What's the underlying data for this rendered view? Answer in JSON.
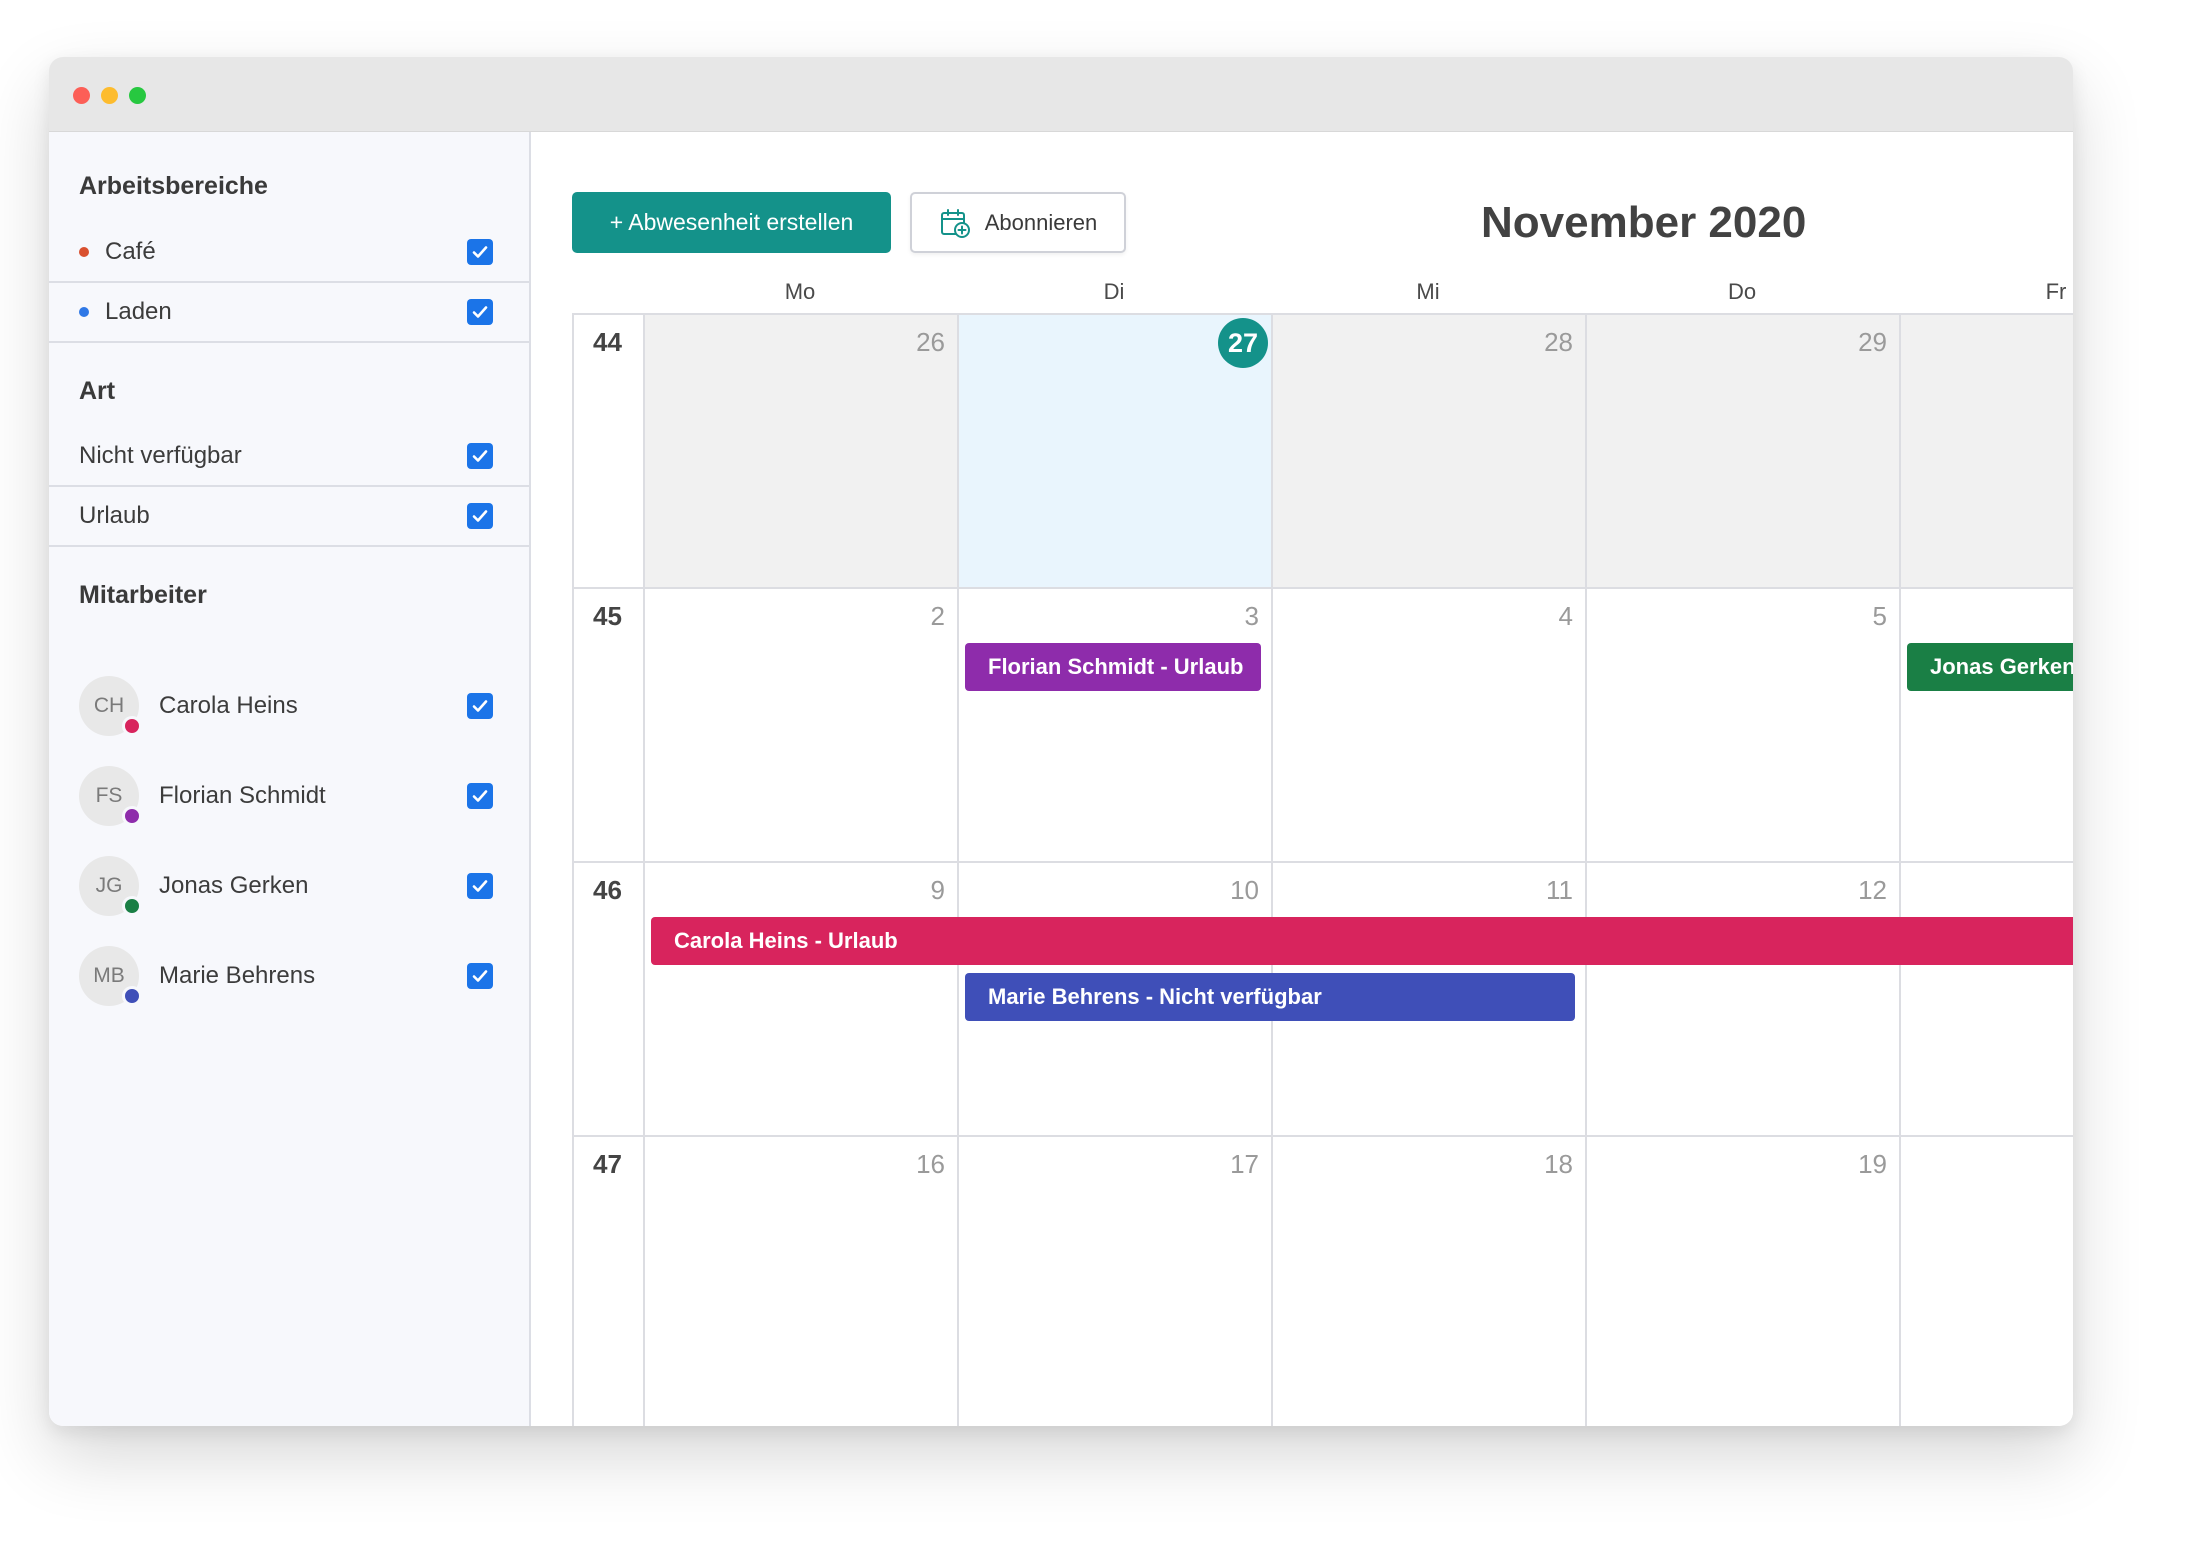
{
  "sidebar": {
    "workspaces": {
      "heading": "Arbeitsbereiche",
      "items": [
        {
          "label": "Café",
          "color": "#d9502f",
          "checked": true
        },
        {
          "label": "Laden",
          "color": "#2f78e6",
          "checked": true
        }
      ]
    },
    "types": {
      "heading": "Art",
      "items": [
        {
          "label": "Nicht verfügbar",
          "checked": true
        },
        {
          "label": "Urlaub",
          "checked": true
        }
      ]
    },
    "employees": {
      "heading": "Mitarbeiter",
      "items": [
        {
          "initials": "CH",
          "name": "Carola Heins",
          "color": "#d8245d",
          "checked": true
        },
        {
          "initials": "FS",
          "name": "Florian Schmidt",
          "color": "#8e2cab",
          "checked": true
        },
        {
          "initials": "JG",
          "name": "Jonas Gerken",
          "color": "#1a7f45",
          "checked": true
        },
        {
          "initials": "MB",
          "name": "Marie Behrens",
          "color": "#3f4fb8",
          "checked": true
        }
      ]
    }
  },
  "toolbar": {
    "create_label": "+ Abwesenheit erstellen",
    "subscribe_label": "Abonnieren",
    "subscribe_icon": "calendar-plus-icon"
  },
  "calendar": {
    "month_title": "November 2020",
    "weekdays": [
      "Mo",
      "Di",
      "Mi",
      "Do",
      "Fr"
    ],
    "weeks": [
      {
        "number": "44",
        "days": [
          "26",
          "27",
          "28",
          "29",
          ""
        ]
      },
      {
        "number": "45",
        "days": [
          "2",
          "3",
          "4",
          "5",
          ""
        ]
      },
      {
        "number": "46",
        "days": [
          "9",
          "10",
          "11",
          "12",
          ""
        ]
      },
      {
        "number": "47",
        "days": [
          "16",
          "17",
          "18",
          "19",
          ""
        ]
      }
    ],
    "today": "27",
    "events": [
      {
        "label": "Florian Schmidt - Urlaub",
        "color": "#8e2cab"
      },
      {
        "label": "Jonas Gerken",
        "color": "#1a7f45"
      },
      {
        "label": "Carola Heins - Urlaub",
        "color": "#d8245d"
      },
      {
        "label": "Marie Behrens - Nicht verfügbar",
        "color": "#3f4fb8"
      }
    ]
  },
  "colors": {
    "accent": "#14928a",
    "checkbox": "#1b74e8"
  }
}
